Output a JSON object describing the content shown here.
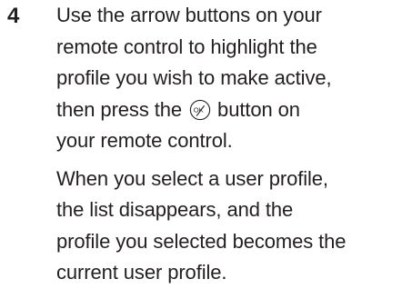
{
  "step": {
    "number": "4",
    "para1": {
      "line1": "Use the arrow buttons on your",
      "line2": "remote control to highlight the",
      "line3": "profile you wish to make active,",
      "line4_before": "then press the ",
      "line4_after": " button on",
      "line5": "your remote control.",
      "icon": "ok-button-icon",
      "icon_label": "OK"
    },
    "para2": {
      "line1": "When you select a user profile,",
      "line2": "the list disappears, and the",
      "line3": "profile you selected becomes the",
      "line4": "current user profile."
    }
  }
}
